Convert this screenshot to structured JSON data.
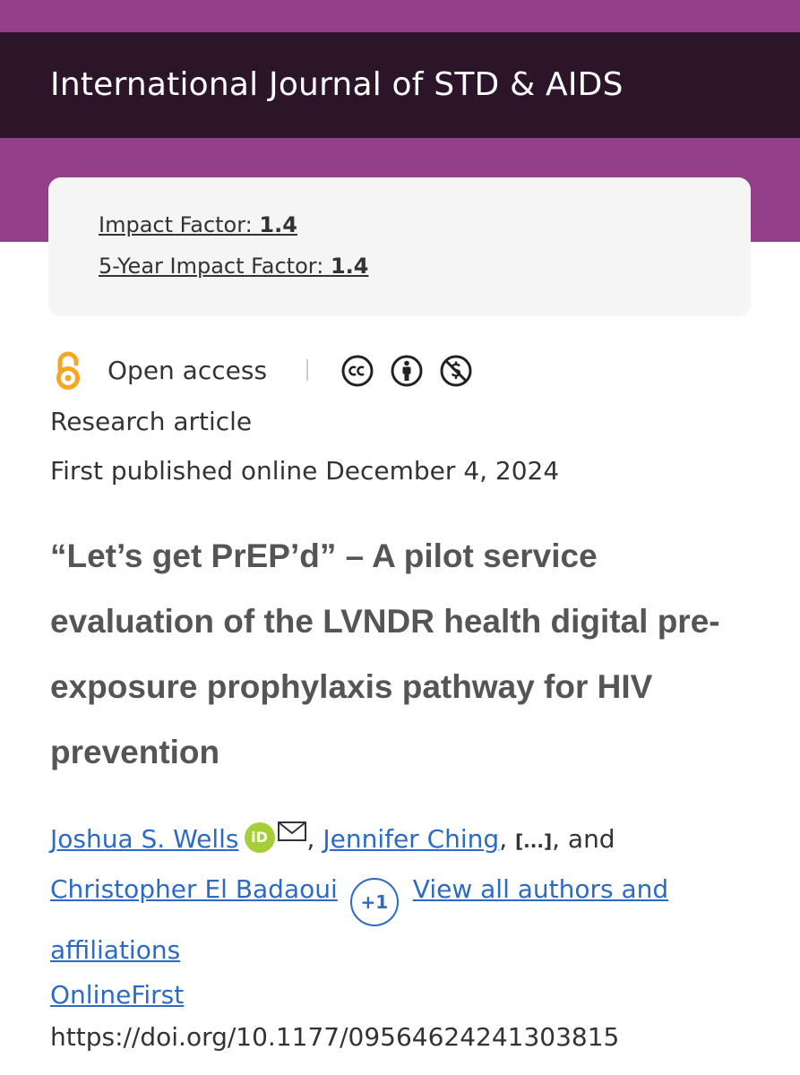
{
  "header": {
    "journal_title": "International Journal of STD & AIDS",
    "colors": {
      "purple": "#933f8a",
      "dark": "#2c1529"
    }
  },
  "metrics": {
    "impact_factor_label": "Impact Factor:",
    "impact_factor_value": "1.4",
    "five_year_label": "5-Year Impact Factor:",
    "five_year_value": "1.4"
  },
  "access": {
    "label": "Open access",
    "icons": [
      "open-access-icon",
      "creative-commons-icon",
      "attribution-icon",
      "non-commercial-icon"
    ]
  },
  "article": {
    "type": "Research article",
    "published": "First published online December 4, 2024",
    "title": "“Let’s get PrEP’d” – A pilot service evaluation of the LVNDR health digital pre-exposure prophylaxis pathway for HIV prevention"
  },
  "authors": {
    "first": "Joshua S. Wells",
    "orcid_label": "iD",
    "second": "Jennifer Ching",
    "ellipsis": "[...]",
    "and": "and",
    "last": "Christopher El Badaoui",
    "more_count": "+1",
    "view_all": "View all authors and affiliations"
  },
  "publication": {
    "section": "OnlineFirst",
    "doi": "https://doi.org/10.1177/09564624241303815"
  }
}
